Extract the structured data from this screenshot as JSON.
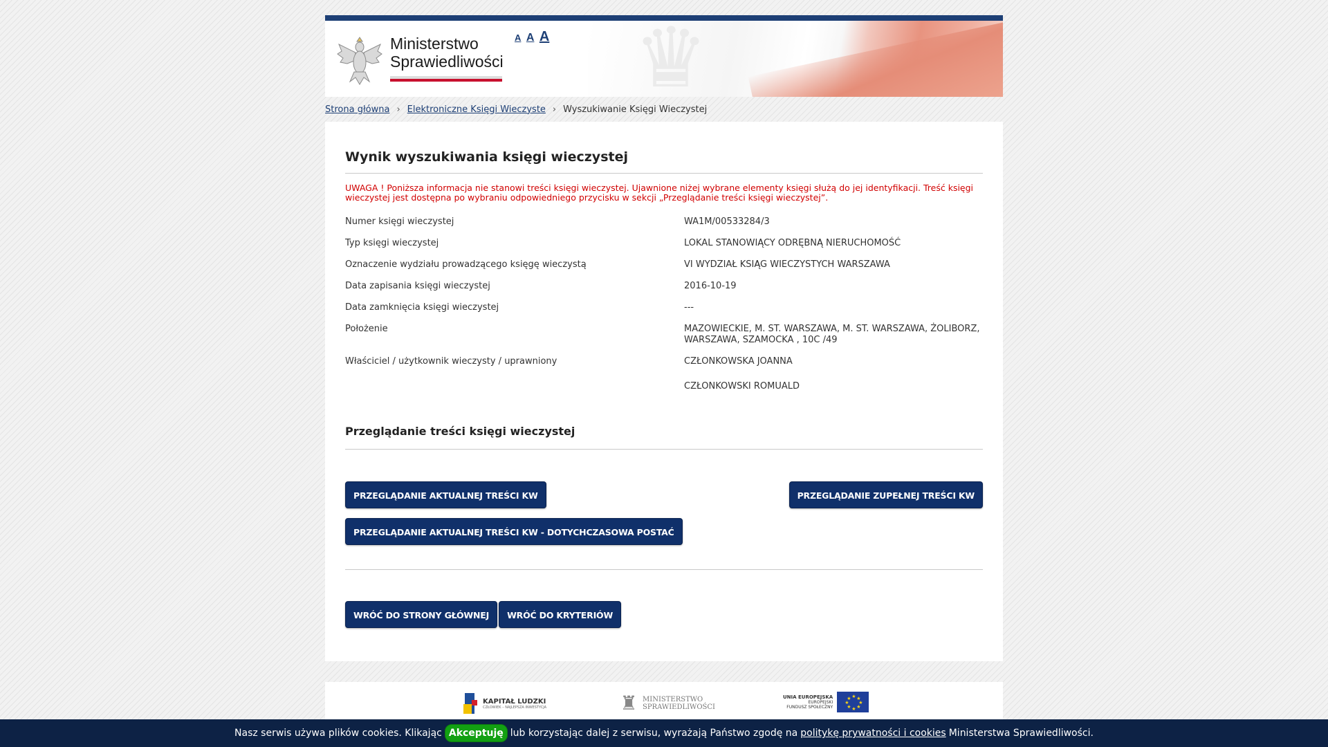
{
  "header": {
    "ministry_line1": "Ministerstwo",
    "ministry_line2": "Sprawiedliwości",
    "font_small": "A",
    "font_medium": "A",
    "font_large": "A"
  },
  "breadcrumb": {
    "items": [
      "Strona główna",
      "Elektroniczne Księgi Wieczyste"
    ],
    "current": "Wyszukiwanie Księgi Wieczystej"
  },
  "result": {
    "title": "Wynik wyszukiwania księgi wieczystej",
    "warning": "UWAGA ! Poniższa informacja nie stanowi treści księgi wieczystej. Ujawnione niżej wybrane elementy księgi służą do jej identyfikacji. Treść księgi wieczystej jest dostępna po wybraniu odpowiedniego przycisku w sekcji „Przeglądanie treści księgi wieczystej”.",
    "rows": [
      {
        "label": "Numer księgi wieczystej",
        "value": "WA1M/00533284/3"
      },
      {
        "label": "Typ księgi wieczystej",
        "value": "LOKAL STANOWIĄCY ODRĘBNĄ NIERUCHOMOŚĆ"
      },
      {
        "label": "Oznaczenie wydziału prowadzącego księgę wieczystą",
        "value": "VI WYDZIAŁ KSIĄG WIECZYSTYCH WARSZAWA"
      },
      {
        "label": "Data zapisania księgi wieczystej",
        "value": "2016-10-19"
      },
      {
        "label": "Data zamknięcia księgi wieczystej",
        "value": "---"
      },
      {
        "label": "Położenie",
        "value": "MAZOWIECKIE, M. ST. WARSZAWA, M. ST. WARSZAWA, ŻOLIBORZ, WARSZAWA, SZAMOCKA , 10C /49"
      }
    ],
    "owner_label": "Właściciel / użytkownik wieczysty / uprawniony",
    "owners": [
      "CZŁONKOWSKA JOANNA",
      "CZŁONKOWSKI ROMUALD"
    ]
  },
  "browse": {
    "title": "Przeglądanie treści księgi wieczystej",
    "btn_current": "PRZEGLĄDANIE AKTUALNEJ TREŚCI KW",
    "btn_full": "PRZEGLĄDANIE ZUPEŁNEJ TREŚCI KW",
    "btn_current_legacy": "PRZEGLĄDANIE AKTUALNEJ TREŚCI KW - DOTYCHCZASOWA POSTAĆ"
  },
  "nav": {
    "btn_home": "WRÓĆ DO STRONY GŁÓWNEJ",
    "btn_criteria": "WRÓĆ DO KRYTERIÓW"
  },
  "footer": {
    "kl_title": "KAPITAŁ LUDZKI",
    "kl_sub": "CZŁOWIEK – NAJLEPSZA INWESTYCJA",
    "ms_line1": "MINISTERSTWO",
    "ms_line2": "SPRAWIEDLIWOŚCI",
    "ue_line1": "UNIA EUROPEJSKA",
    "ue_line2": "EUROPEJSKI",
    "ue_line3": "FUNDUSZ SPOŁECZNY"
  },
  "cookies": {
    "text_before": "Nasz serwis używa plików cookies. Klikając",
    "accept": "Akceptuję",
    "text_middle": "lub korzystając dalej z serwisu, wyrażają Państwo zgodę na",
    "link": "politykę prywatności i cookies",
    "text_after": "Ministerstwa Sprawiedliwości."
  }
}
